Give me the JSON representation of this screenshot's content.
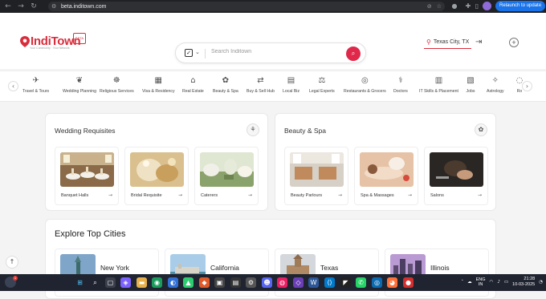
{
  "browser": {
    "url": "beta.inditown.com",
    "relaunch_label": "Relaunch to update"
  },
  "header": {
    "brand": "IndiTown",
    "tagline": "Your Community · Your Network",
    "beta_label": "BETA",
    "location": "Texas City, TX"
  },
  "search": {
    "placeholder": "Search Inditown"
  },
  "categories": [
    "Travel & Tours",
    "Wedding Planning",
    "Religious Services",
    "Visa & Residency",
    "Real Estate",
    "Beauty & Spa",
    "Buy & Sell Hub",
    "Local Biz",
    "Legal Experts",
    "Restaurants & Grocers",
    "Doctors",
    "IT Skills & Placement",
    "Jobs",
    "Astrology",
    "Ro"
  ],
  "wedding": {
    "title": "Wedding Requisites",
    "items": [
      "Banquet Halls",
      "Bridal Requisite",
      "Caterers"
    ]
  },
  "beauty": {
    "title": "Beauty & Spa",
    "items": [
      "Beauty Parlours",
      "Spa & Massages",
      "Salons"
    ]
  },
  "cities": {
    "title": "Explore Top Cities",
    "items": [
      "New York",
      "California",
      "Texas",
      "Illinois"
    ]
  },
  "taskbar": {
    "lang1": "ENG",
    "lang2": "IN",
    "time": "21:28",
    "date": "10-03-2025",
    "notification_count": "1"
  },
  "colors": {
    "brand": "#d92d3c",
    "search_button": "#e0284a",
    "taskbar": "#1f2430",
    "relaunch": "#1a73e8"
  }
}
